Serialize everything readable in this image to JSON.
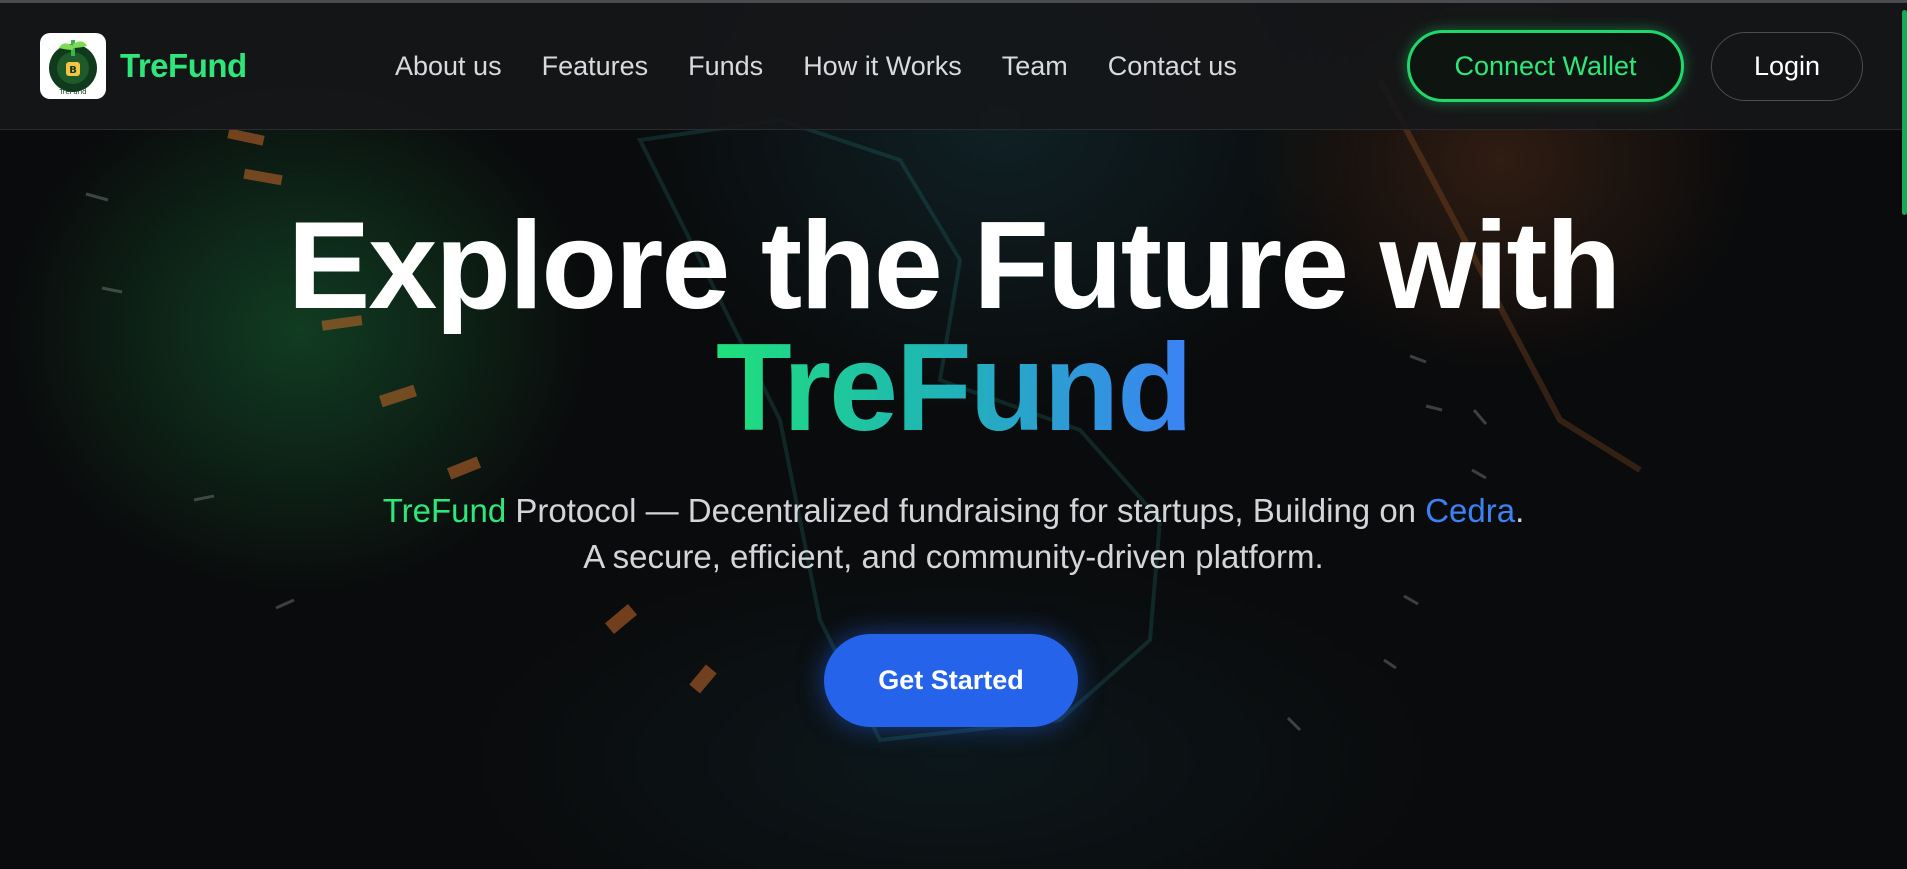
{
  "brand": {
    "name": "TreFund",
    "logo_text": "TreFund"
  },
  "nav": {
    "links": [
      "About us",
      "Features",
      "Funds",
      "How it Works",
      "Team",
      "Contact us"
    ],
    "connect_wallet": "Connect Wallet",
    "login": "Login"
  },
  "hero": {
    "title_line1": "Explore the Future with",
    "title_line2": "TreFund",
    "subtitle": {
      "brand": "TreFund",
      "text1": " Protocol — Decentralized fundraising for startups, Building on ",
      "chain": "Cedra",
      "end": "."
    },
    "subtitle_line2": "A secure, efficient, and community-driven platform.",
    "cta": "Get Started"
  },
  "colors": {
    "accent_green": "#2ee67a",
    "accent_blue": "#3b82f6",
    "button_blue": "#2563eb",
    "background": "#0a0b0c"
  },
  "icons": {
    "logo": "trefund-logo-icon"
  }
}
